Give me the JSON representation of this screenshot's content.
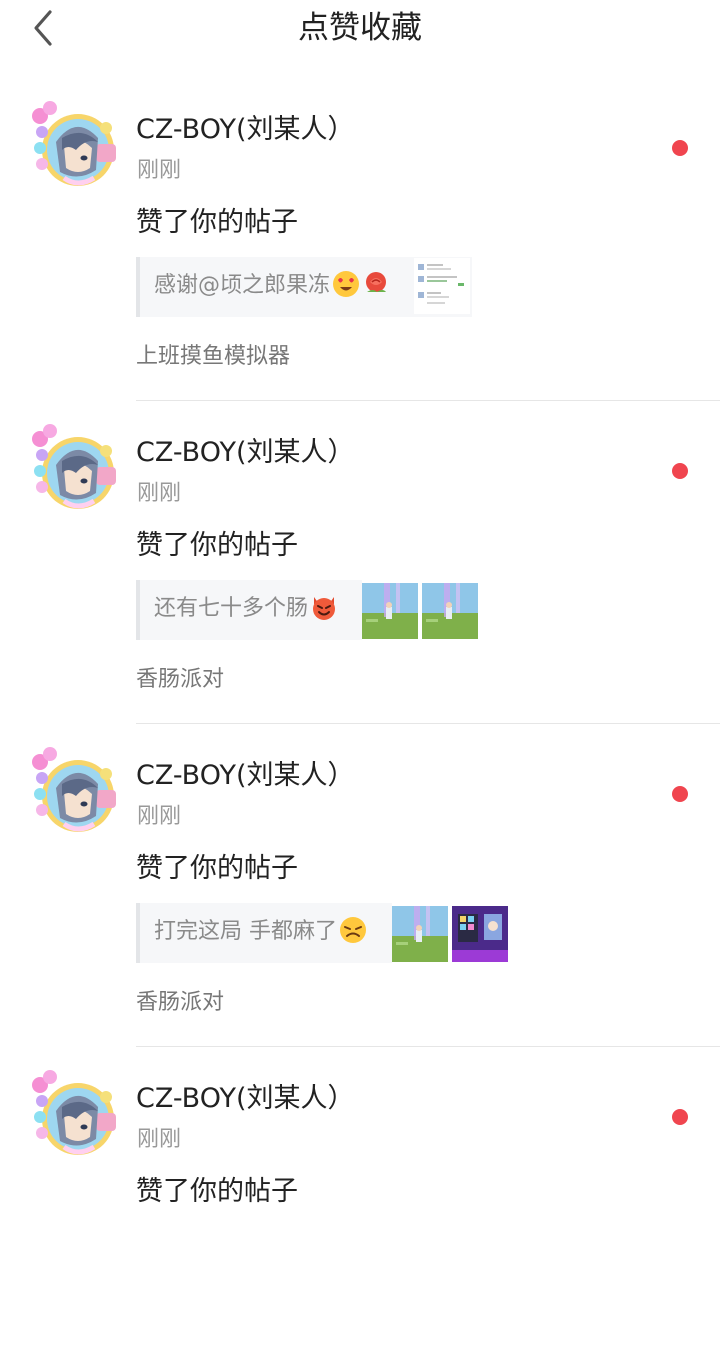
{
  "header": {
    "title": "点赞收藏"
  },
  "notifications": [
    {
      "username": "CZ-BOY(刘某人）",
      "time": "刚刚",
      "action": "赞了你的帖子",
      "post_text": "感谢@顷之郎果冻",
      "emojis": [
        "heart-eyes-emoji",
        "rose-emoji"
      ],
      "thumbnails": [
        "screenshot-thumb"
      ],
      "tag": "上班摸鱼模拟器",
      "unread": true
    },
    {
      "username": "CZ-BOY(刘某人）",
      "time": "刚刚",
      "action": "赞了你的帖子",
      "post_text": "还有七十多个肠",
      "emojis": [
        "devil-emoji"
      ],
      "thumbnails": [
        "game-scene-thumb",
        "game-scene-thumb"
      ],
      "tag": "香肠派对",
      "unread": true
    },
    {
      "username": "CZ-BOY(刘某人）",
      "time": "刚刚",
      "action": "赞了你的帖子",
      "post_text": "打完这局 手都麻了",
      "emojis": [
        "tired-emoji"
      ],
      "thumbnails": [
        "game-scene-thumb",
        "game-menu-thumb"
      ],
      "tag": "香肠派对",
      "unread": true
    },
    {
      "username": "CZ-BOY(刘某人）",
      "time": "刚刚",
      "action": "赞了你的帖子",
      "unread": true
    }
  ],
  "colors": {
    "unread_dot": "#f0454f",
    "muted_text": "#999999"
  }
}
